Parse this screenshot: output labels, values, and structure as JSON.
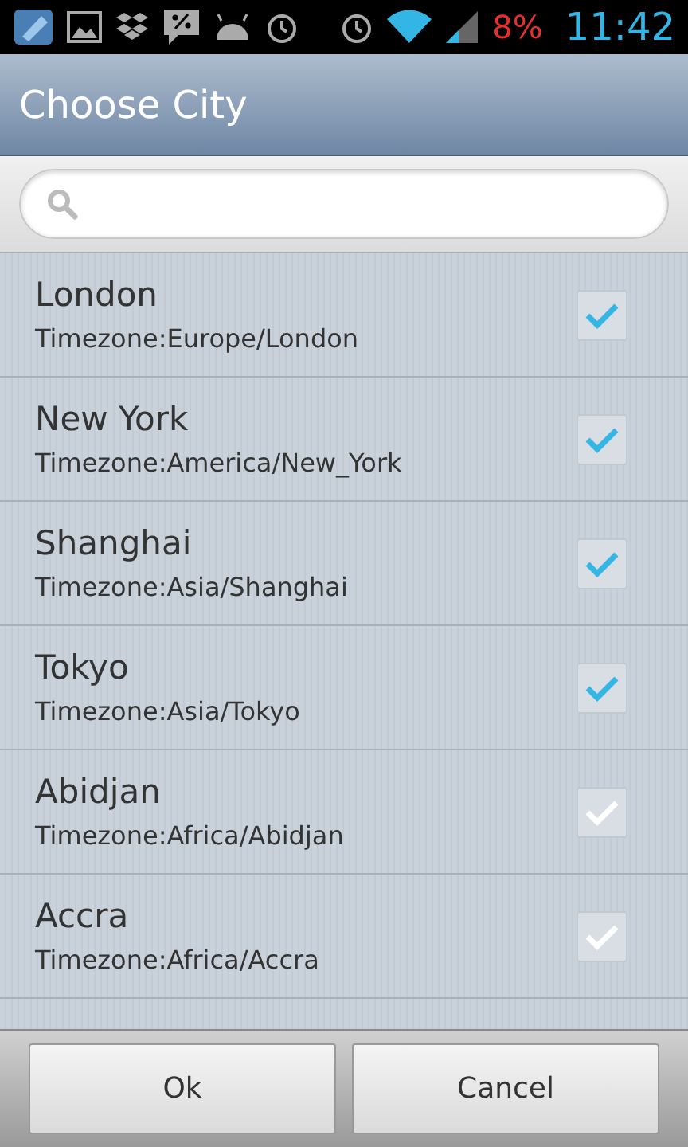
{
  "status_bar": {
    "battery": "8%",
    "time": "11:42"
  },
  "window": {
    "title": "Choose City"
  },
  "cities": [
    {
      "name": "London",
      "timezone": "Timezone:Europe/London",
      "checked": true
    },
    {
      "name": "New York",
      "timezone": "Timezone:America/New_York",
      "checked": true
    },
    {
      "name": "Shanghai",
      "timezone": "Timezone:Asia/Shanghai",
      "checked": true
    },
    {
      "name": "Tokyo",
      "timezone": "Timezone:Asia/Tokyo",
      "checked": true
    },
    {
      "name": "Abidjan",
      "timezone": "Timezone:Africa/Abidjan",
      "checked": false
    },
    {
      "name": "Accra",
      "timezone": "Timezone:Africa/Accra",
      "checked": false
    }
  ],
  "buttons": [
    "Ok",
    "Cancel"
  ]
}
